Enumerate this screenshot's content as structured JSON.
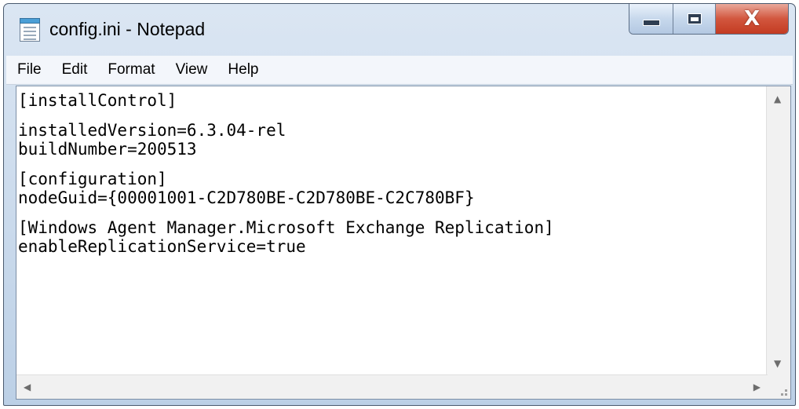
{
  "window": {
    "title": "config.ini - Notepad",
    "accent_close": "#c8432a"
  },
  "caption_buttons": {
    "close_symbol": "X"
  },
  "menu": [
    "File",
    "Edit",
    "Format",
    "View",
    "Help"
  ],
  "editor": {
    "lines": [
      "[installControl]",
      "installedVersion=6.3.04-rel",
      "buildNumber=200513",
      "[configuration]",
      "nodeGuid={00001001-C2D780BE-C2D780BE-C2C780BF}",
      "[Windows Agent Manager.Microsoft Exchange Replication]",
      "enableReplicationService=true"
    ]
  },
  "scrollbars": {
    "up": "▲",
    "down": "▼",
    "left": "◀",
    "right": "▶"
  }
}
